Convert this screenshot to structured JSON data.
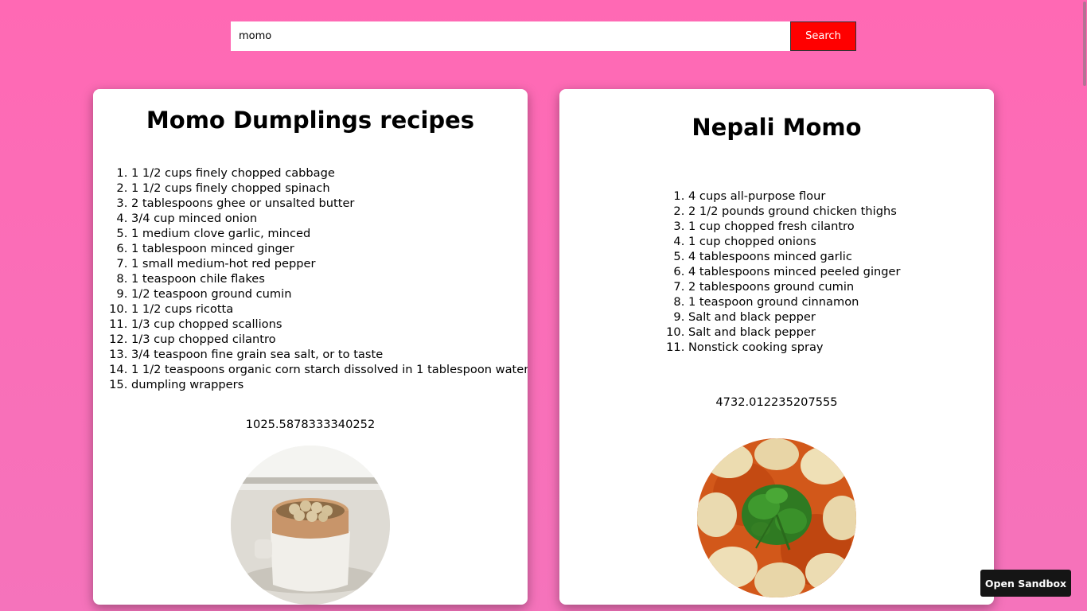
{
  "search": {
    "value": "momo",
    "button_label": "Search"
  },
  "recipes": [
    {
      "title": "Momo Dumplings recipes",
      "ingredients": [
        "1 1/2 cups finely chopped cabbage",
        "1 1/2 cups finely chopped spinach",
        "2 tablespoons ghee or unsalted butter",
        "3/4 cup minced onion",
        "1 medium clove garlic, minced",
        "1 tablespoon minced ginger",
        "1 small medium-hot red pepper",
        "1 teaspoon chile flakes",
        "1/2 teaspoon ground cumin",
        "1 1/2 cups ricotta",
        "1/3 cup chopped scallions",
        "1/3 cup chopped cilantro",
        "3/4 teaspoon fine grain sea salt, or to taste",
        "1 1/2 teaspoons organic corn starch dissolved in 1 tablespoon water",
        "dumpling wrappers"
      ],
      "calories": "1025.5878333340252"
    },
    {
      "title": "Nepali Momo",
      "ingredients": [
        "4 cups all-purpose flour",
        "2 1/2 pounds ground chicken thighs",
        "1 cup chopped fresh cilantro",
        "1 cup chopped onions",
        "4 tablespoons minced garlic",
        "4 tablespoons minced peeled ginger",
        "2 tablespoons ground cumin",
        "1 teaspoon ground cinnamon",
        "Salt and black pepper",
        "Salt and black pepper",
        "Nonstick cooking spray"
      ],
      "calories": "4732.012235207555"
    }
  ],
  "sandbox_button": "Open Sandbox"
}
